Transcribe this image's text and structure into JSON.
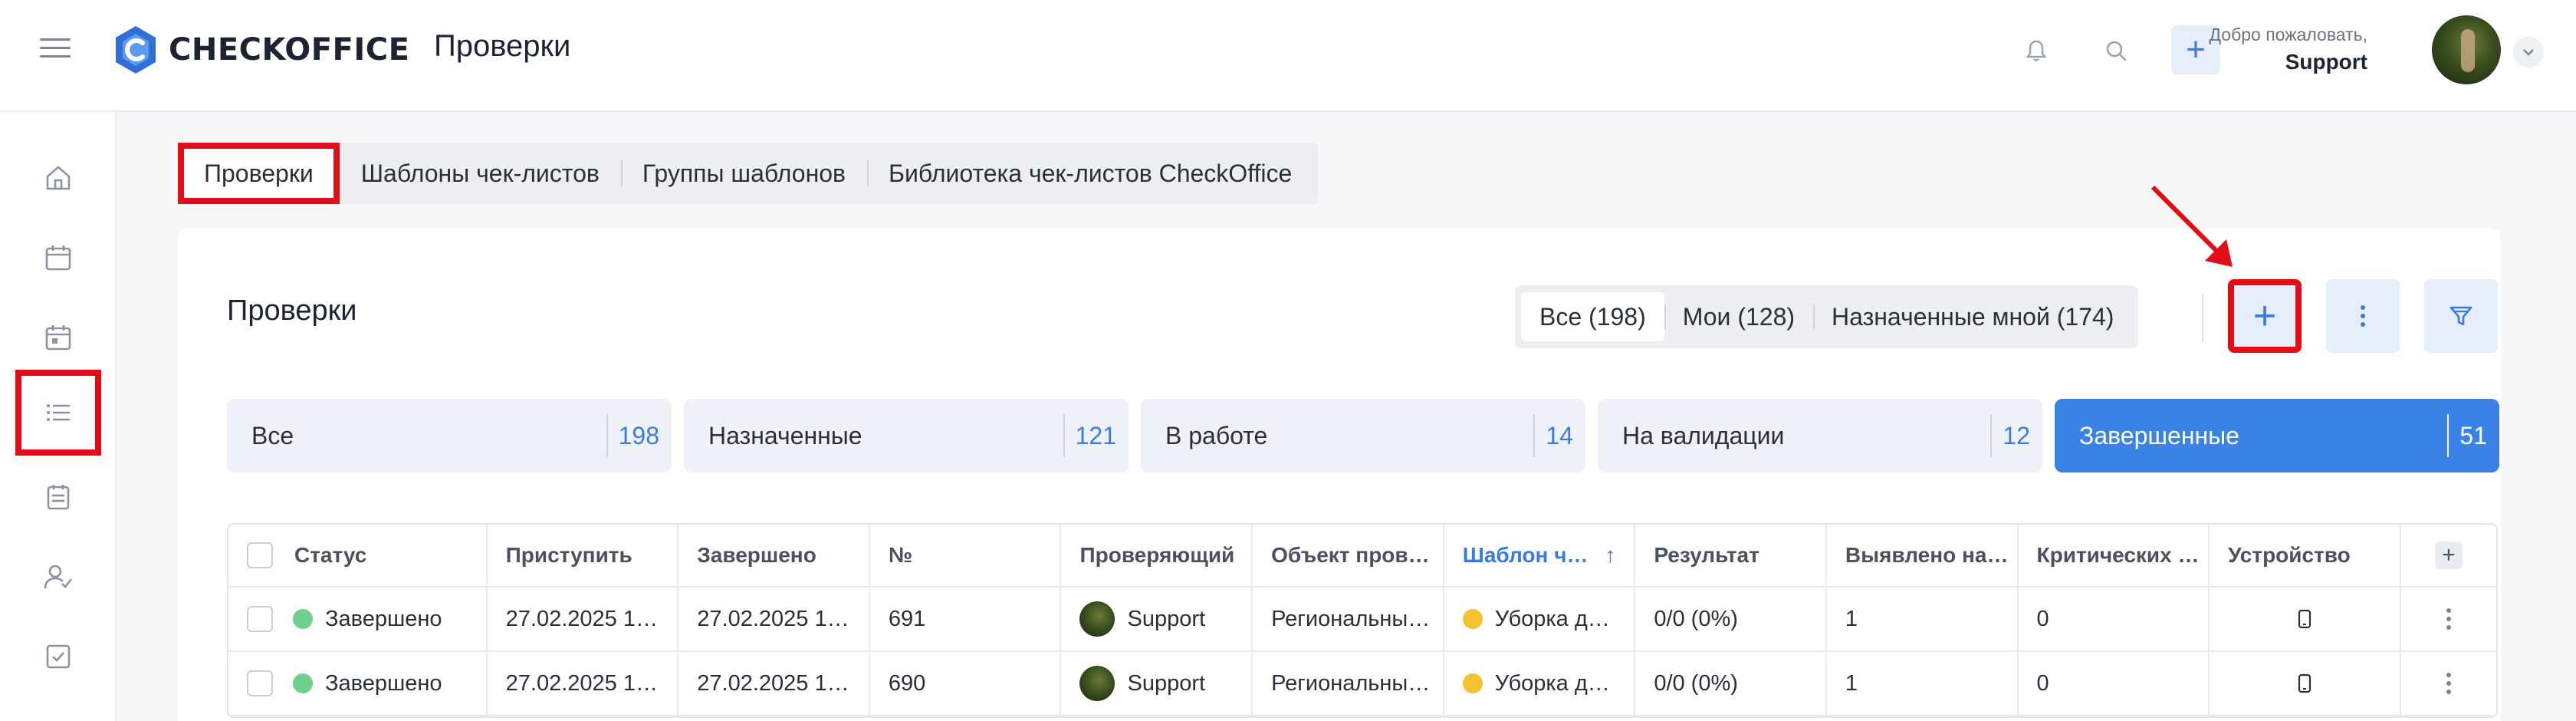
{
  "header": {
    "brand": "CHECKOFFICE",
    "page_title": "Проверки",
    "welcome": "Добро пожаловать,",
    "user": "Support",
    "add_symbol": "+"
  },
  "sidebar": {
    "items": [
      {
        "icon": "home-icon"
      },
      {
        "icon": "calendar-icon"
      },
      {
        "icon": "calendar-day-icon"
      },
      {
        "icon": "list-icon",
        "active": true
      },
      {
        "icon": "clipboard-calendar-icon"
      },
      {
        "icon": "user-check-icon"
      },
      {
        "icon": "checkbox-icon"
      }
    ]
  },
  "tabs": [
    {
      "label": "Проверки",
      "active": true
    },
    {
      "label": "Шаблоны чек-листов"
    },
    {
      "label": "Группы шаблонов"
    },
    {
      "label": "Библиотека чек-листов CheckOffice"
    }
  ],
  "main": {
    "title": "Проверки",
    "segments": [
      {
        "label": "Все (198)",
        "active": true
      },
      {
        "label": "Мои (128)"
      },
      {
        "label": "Назначенные мной (174)"
      }
    ],
    "add_symbol": "+",
    "status_cards": [
      {
        "label": "Все",
        "count": "198"
      },
      {
        "label": "Назначенные",
        "count": "121"
      },
      {
        "label": "В работе",
        "count": "14"
      },
      {
        "label": "На валидации",
        "count": "12"
      },
      {
        "label": "Завершенные",
        "count": "51",
        "selected": true
      }
    ]
  },
  "table": {
    "columns": [
      "Статус",
      "Приступить",
      "Завершено",
      "№",
      "Проверяющий",
      "Объект пров…",
      "Шаблон ч…",
      "Результат",
      "Выявлено на…",
      "Критических …",
      "Устройство"
    ],
    "sort_arrow": "↑",
    "add_col": "+",
    "rows": [
      {
        "status": "Завершено",
        "start": "27.02.2025 1…",
        "end": "27.02.2025 1…",
        "number": "691",
        "inspector": "Support",
        "object": "Региональны…",
        "template": "Уборка д…",
        "result": "0/0 (0%)",
        "found": "1",
        "critical": "0"
      },
      {
        "status": "Завершено",
        "start": "27.02.2025 1…",
        "end": "27.02.2025 1…",
        "number": "690",
        "inspector": "Support",
        "object": "Региональны…",
        "template": "Уборка д…",
        "result": "0/0 (0%)",
        "found": "1",
        "critical": "0"
      }
    ]
  },
  "colors": {
    "accent": "#3b7be0",
    "highlight": "#e20d17",
    "selected_card": "#3b82e6"
  }
}
